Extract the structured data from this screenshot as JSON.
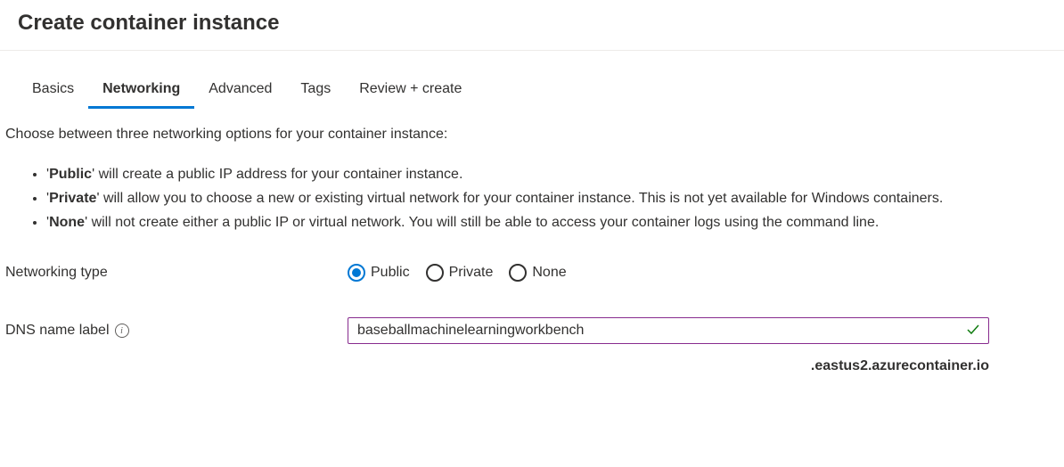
{
  "page": {
    "title": "Create container instance"
  },
  "tabs": [
    {
      "label": "Basics",
      "active": false
    },
    {
      "label": "Networking",
      "active": true
    },
    {
      "label": "Advanced",
      "active": false
    },
    {
      "label": "Tags",
      "active": false
    },
    {
      "label": "Review + create",
      "active": false
    }
  ],
  "intro": "Choose between three networking options for your container instance:",
  "bullets": {
    "public_bold": "Public",
    "public_rest": "' will create a public IP address for your container instance.",
    "private_bold": "Private",
    "private_rest": "' will allow you to choose a new or existing virtual network for your container instance. This is not yet available for Windows containers.",
    "none_bold": "None",
    "none_rest": "' will not create either a public IP or virtual network. You will still be able to access your container logs using the command line."
  },
  "form": {
    "networking_type_label": "Networking type",
    "options": {
      "public": "Public",
      "private": "Private",
      "none": "None"
    },
    "selected": "public",
    "dns_label": "DNS name label",
    "dns_value": "baseballmachinelearningworkbench",
    "dns_suffix": ".eastus2.azurecontainer.io"
  }
}
